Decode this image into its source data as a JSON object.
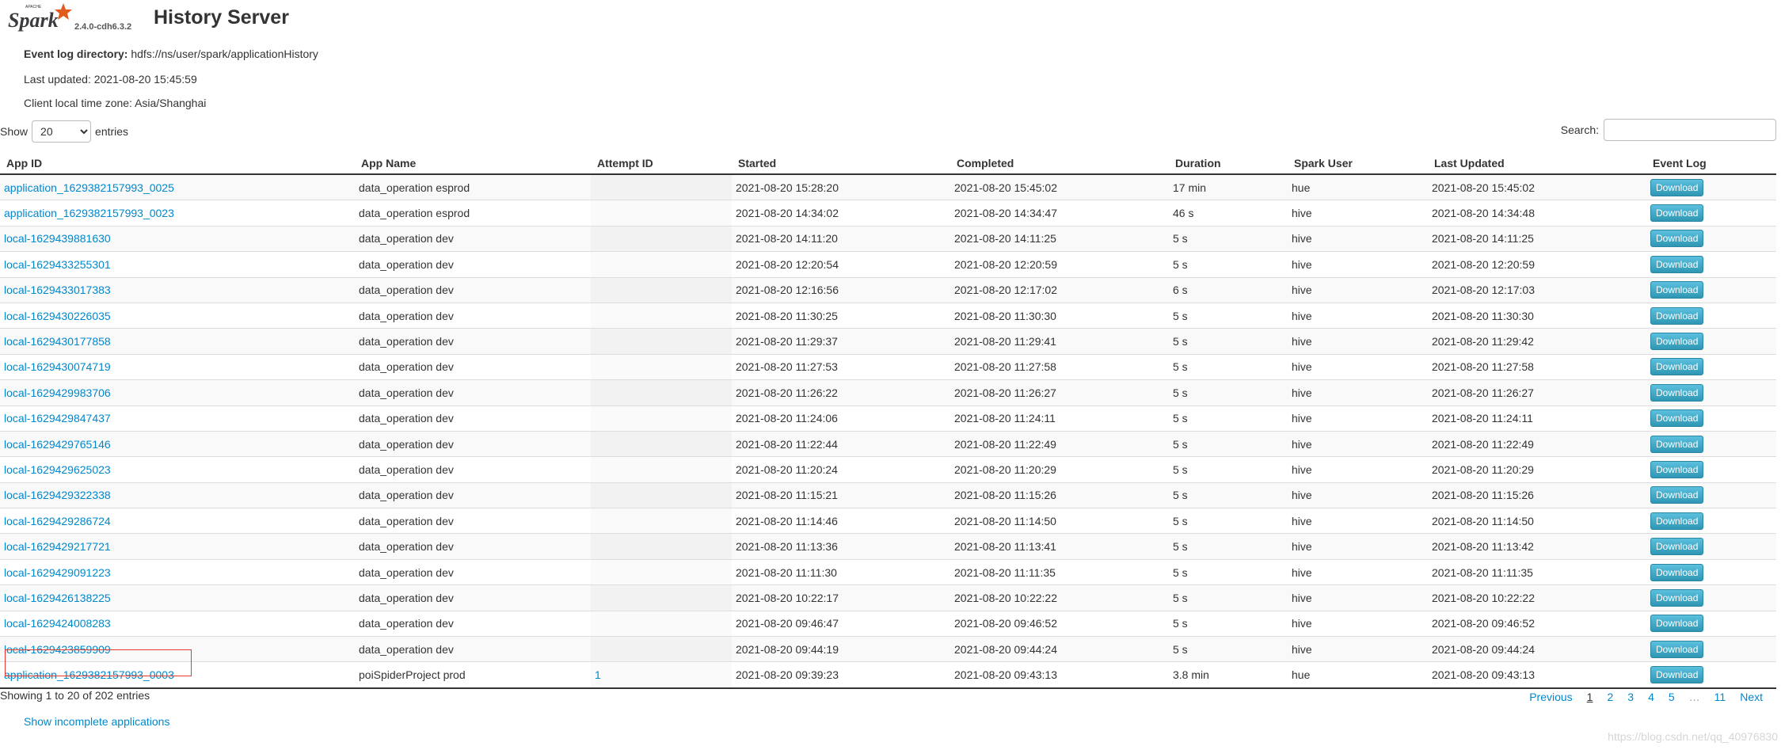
{
  "brand": {
    "apache_text": "APACHE",
    "logo_text": "Spark",
    "version": "2.4.0-cdh6.3.2"
  },
  "title": "History Server",
  "info": {
    "event_log_label": "Event log directory:",
    "event_log_value": "hdfs://ns/user/spark/applicationHistory",
    "last_updated": "Last updated: 2021-08-20 15:45:59",
    "timezone": "Client local time zone: Asia/Shanghai"
  },
  "controls": {
    "show_label": "Show",
    "entries_value": "20",
    "entries_label": "entries",
    "search_label": "Search:"
  },
  "table": {
    "headers": [
      "App ID",
      "App Name",
      "Attempt ID",
      "Started",
      "Completed",
      "Duration",
      "Spark User",
      "Last Updated",
      "Event Log"
    ],
    "download_label": "Download",
    "rows": [
      {
        "app_id": "application_1629382157993_0025",
        "app_name": "data_operation esprod",
        "attempt": "",
        "started": "2021-08-20 15:28:20",
        "completed": "2021-08-20 15:45:02",
        "duration": "17 min",
        "user": "hue",
        "last_updated": "2021-08-20 15:45:02"
      },
      {
        "app_id": "application_1629382157993_0023",
        "app_name": "data_operation esprod",
        "attempt": "",
        "started": "2021-08-20 14:34:02",
        "completed": "2021-08-20 14:34:47",
        "duration": "46 s",
        "user": "hive",
        "last_updated": "2021-08-20 14:34:48"
      },
      {
        "app_id": "local-1629439881630",
        "app_name": "data_operation dev",
        "attempt": "",
        "started": "2021-08-20 14:11:20",
        "completed": "2021-08-20 14:11:25",
        "duration": "5 s",
        "user": "hive",
        "last_updated": "2021-08-20 14:11:25"
      },
      {
        "app_id": "local-1629433255301",
        "app_name": "data_operation dev",
        "attempt": "",
        "started": "2021-08-20 12:20:54",
        "completed": "2021-08-20 12:20:59",
        "duration": "5 s",
        "user": "hive",
        "last_updated": "2021-08-20 12:20:59"
      },
      {
        "app_id": "local-1629433017383",
        "app_name": "data_operation dev",
        "attempt": "",
        "started": "2021-08-20 12:16:56",
        "completed": "2021-08-20 12:17:02",
        "duration": "6 s",
        "user": "hive",
        "last_updated": "2021-08-20 12:17:03"
      },
      {
        "app_id": "local-1629430226035",
        "app_name": "data_operation dev",
        "attempt": "",
        "started": "2021-08-20 11:30:25",
        "completed": "2021-08-20 11:30:30",
        "duration": "5 s",
        "user": "hive",
        "last_updated": "2021-08-20 11:30:30"
      },
      {
        "app_id": "local-1629430177858",
        "app_name": "data_operation dev",
        "attempt": "",
        "started": "2021-08-20 11:29:37",
        "completed": "2021-08-20 11:29:41",
        "duration": "5 s",
        "user": "hive",
        "last_updated": "2021-08-20 11:29:42"
      },
      {
        "app_id": "local-1629430074719",
        "app_name": "data_operation dev",
        "attempt": "",
        "started": "2021-08-20 11:27:53",
        "completed": "2021-08-20 11:27:58",
        "duration": "5 s",
        "user": "hive",
        "last_updated": "2021-08-20 11:27:58"
      },
      {
        "app_id": "local-1629429983706",
        "app_name": "data_operation dev",
        "attempt": "",
        "started": "2021-08-20 11:26:22",
        "completed": "2021-08-20 11:26:27",
        "duration": "5 s",
        "user": "hive",
        "last_updated": "2021-08-20 11:26:27"
      },
      {
        "app_id": "local-1629429847437",
        "app_name": "data_operation dev",
        "attempt": "",
        "started": "2021-08-20 11:24:06",
        "completed": "2021-08-20 11:24:11",
        "duration": "5 s",
        "user": "hive",
        "last_updated": "2021-08-20 11:24:11"
      },
      {
        "app_id": "local-1629429765146",
        "app_name": "data_operation dev",
        "attempt": "",
        "started": "2021-08-20 11:22:44",
        "completed": "2021-08-20 11:22:49",
        "duration": "5 s",
        "user": "hive",
        "last_updated": "2021-08-20 11:22:49"
      },
      {
        "app_id": "local-1629429625023",
        "app_name": "data_operation dev",
        "attempt": "",
        "started": "2021-08-20 11:20:24",
        "completed": "2021-08-20 11:20:29",
        "duration": "5 s",
        "user": "hive",
        "last_updated": "2021-08-20 11:20:29"
      },
      {
        "app_id": "local-1629429322338",
        "app_name": "data_operation dev",
        "attempt": "",
        "started": "2021-08-20 11:15:21",
        "completed": "2021-08-20 11:15:26",
        "duration": "5 s",
        "user": "hive",
        "last_updated": "2021-08-20 11:15:26"
      },
      {
        "app_id": "local-1629429286724",
        "app_name": "data_operation dev",
        "attempt": "",
        "started": "2021-08-20 11:14:46",
        "completed": "2021-08-20 11:14:50",
        "duration": "5 s",
        "user": "hive",
        "last_updated": "2021-08-20 11:14:50"
      },
      {
        "app_id": "local-1629429217721",
        "app_name": "data_operation dev",
        "attempt": "",
        "started": "2021-08-20 11:13:36",
        "completed": "2021-08-20 11:13:41",
        "duration": "5 s",
        "user": "hive",
        "last_updated": "2021-08-20 11:13:42"
      },
      {
        "app_id": "local-1629429091223",
        "app_name": "data_operation dev",
        "attempt": "",
        "started": "2021-08-20 11:11:30",
        "completed": "2021-08-20 11:11:35",
        "duration": "5 s",
        "user": "hive",
        "last_updated": "2021-08-20 11:11:35"
      },
      {
        "app_id": "local-1629426138225",
        "app_name": "data_operation dev",
        "attempt": "",
        "started": "2021-08-20 10:22:17",
        "completed": "2021-08-20 10:22:22",
        "duration": "5 s",
        "user": "hive",
        "last_updated": "2021-08-20 10:22:22"
      },
      {
        "app_id": "local-1629424008283",
        "app_name": "data_operation dev",
        "attempt": "",
        "started": "2021-08-20 09:46:47",
        "completed": "2021-08-20 09:46:52",
        "duration": "5 s",
        "user": "hive",
        "last_updated": "2021-08-20 09:46:52"
      },
      {
        "app_id": "local-1629423859909",
        "app_name": "data_operation dev",
        "attempt": "",
        "started": "2021-08-20 09:44:19",
        "completed": "2021-08-20 09:44:24",
        "duration": "5 s",
        "user": "hive",
        "last_updated": "2021-08-20 09:44:24"
      },
      {
        "app_id": "application_1629382157993_0003",
        "app_name": "poiSpiderProject prod",
        "attempt": "1",
        "started": "2021-08-20 09:39:23",
        "completed": "2021-08-20 09:43:13",
        "duration": "3.8 min",
        "user": "hue",
        "last_updated": "2021-08-20 09:43:13"
      }
    ]
  },
  "footer": {
    "showing": "Showing 1 to 20 of 202 entries",
    "previous": "Previous",
    "pages": [
      "1",
      "2",
      "3",
      "4",
      "5"
    ],
    "ellipsis": "…",
    "last_page": "11",
    "next": "Next",
    "show_incomplete": "Show incomplete applications",
    "watermark": "https://blog.csdn.net/qq_40976830"
  },
  "colors": {
    "link": "#0088cc",
    "download_button": "#49afcd",
    "logo_orange": "#e25a1c",
    "highlight_border": "#e53935"
  }
}
